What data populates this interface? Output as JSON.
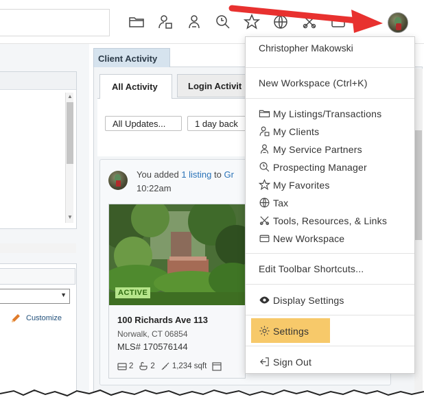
{
  "toolbar": {
    "icons": [
      "folder-icon",
      "clients-icon",
      "service-partners-icon",
      "prospecting-icon",
      "favorites-icon",
      "tax-icon",
      "tools-icon",
      "workspace-icon"
    ]
  },
  "left_panel": {
    "customize_label": "Customize"
  },
  "client_activity": {
    "title": "Client Activity",
    "tabs": [
      "All Activity",
      "Login Activit"
    ],
    "filters": {
      "updates": "All Updates...",
      "period": "1 day back"
    },
    "feed": {
      "text_prefix": "You added ",
      "text_link": "1 listing",
      "text_middle": " to ",
      "text_link2": "Gr",
      "time": "10:22am",
      "listing": {
        "status": "ACTIVE",
        "address": "100 Richards Ave 113",
        "city": "Norwalk, CT 06854",
        "mls": "MLS# 170576144",
        "beds": "2",
        "baths": "2",
        "sqft": "1,234 sqft"
      }
    }
  },
  "menu": {
    "user_name": "Christopher Makowski",
    "new_workspace_shortcut": "New Workspace (Ctrl+K)",
    "items": [
      {
        "icon": "folder-icon",
        "label": "My Listings/Transactions"
      },
      {
        "icon": "clients-icon",
        "label": "My Clients"
      },
      {
        "icon": "service-partners-icon",
        "label": "My Service Partners"
      },
      {
        "icon": "prospecting-icon",
        "label": "Prospecting Manager"
      },
      {
        "icon": "favorites-icon",
        "label": "My Favorites"
      },
      {
        "icon": "tax-icon",
        "label": "Tax"
      },
      {
        "icon": "tools-icon",
        "label": "Tools, Resources, & Links"
      },
      {
        "icon": "workspace-icon",
        "label": "New Workspace"
      }
    ],
    "edit_toolbar": "Edit Toolbar Shortcuts...",
    "display_settings": "Display Settings",
    "settings": "Settings",
    "sign_out": "Sign Out",
    "highlight_color": "#f7c96a"
  },
  "annotation": {
    "arrow_color": "#e8312f"
  }
}
